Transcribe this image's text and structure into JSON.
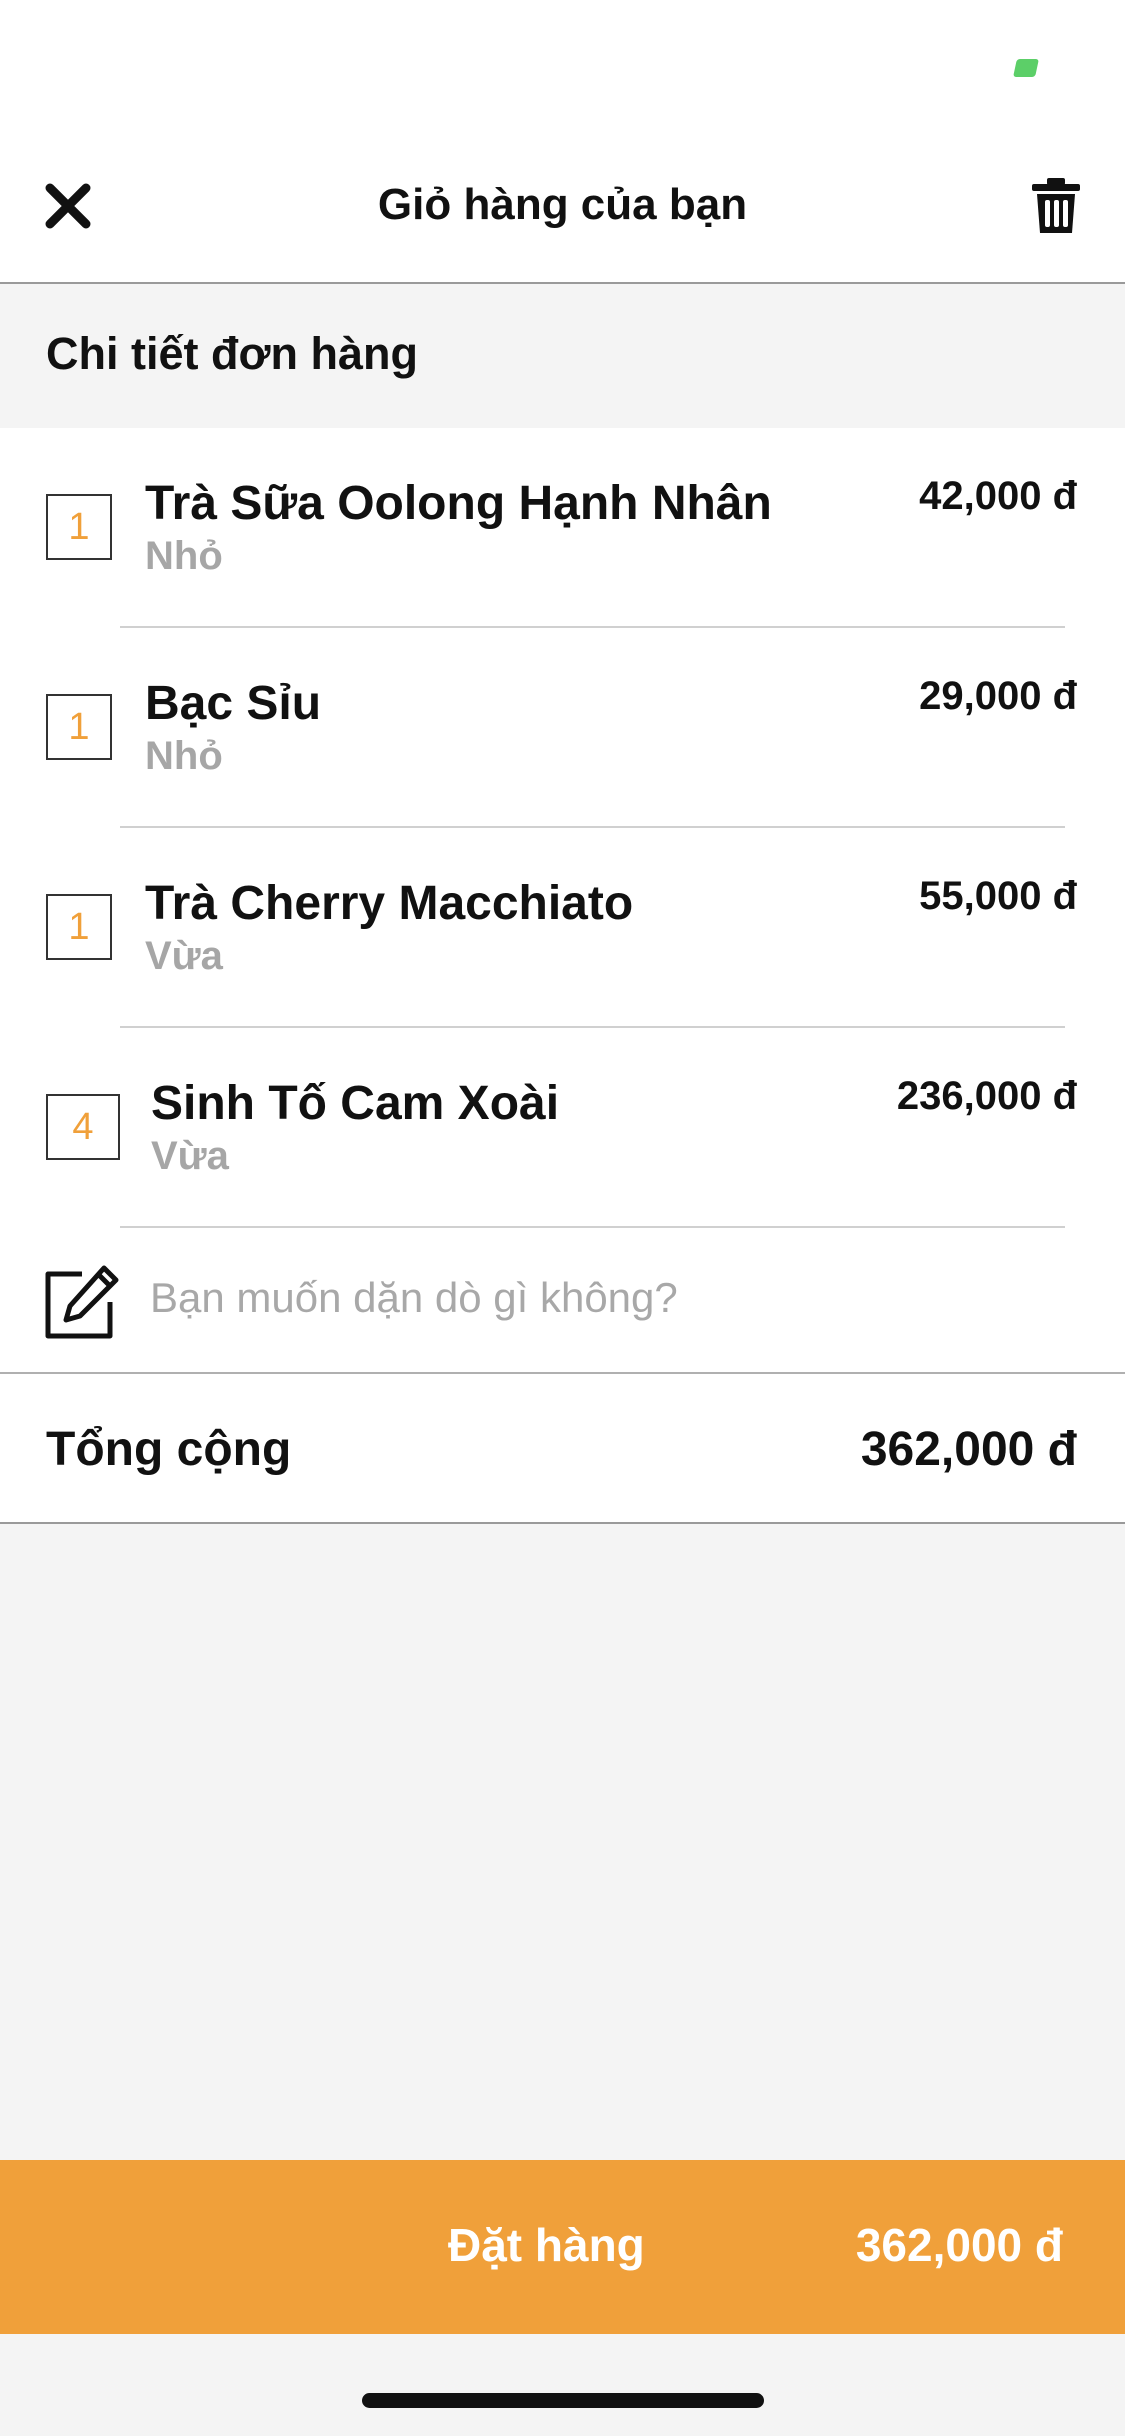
{
  "header": {
    "title": "Giỏ hàng của bạn",
    "close_icon": "close-icon",
    "trash_icon": "trash-icon"
  },
  "section": {
    "title": "Chi tiết đơn hàng"
  },
  "items": [
    {
      "qty": "1",
      "name": "Trà Sữa Oolong Hạnh Nhân",
      "size": "Nhỏ",
      "price": "42,000 đ"
    },
    {
      "qty": "1",
      "name": "Bạc Sỉu",
      "size": "Nhỏ",
      "price": "29,000 đ"
    },
    {
      "qty": "1",
      "name": "Trà Cherry Macchiato",
      "size": "Vừa",
      "price": "55,000 đ"
    },
    {
      "qty": "4",
      "name": "Sinh Tố Cam Xoài",
      "size": "Vừa",
      "price": "236,000 đ"
    }
  ],
  "note": {
    "placeholder": "Bạn muốn dặn dò gì không?",
    "value": "",
    "icon": "edit-note-icon"
  },
  "total": {
    "label": "Tổng cộng",
    "value": "362,000 đ"
  },
  "order_button": {
    "label": "Đặt hàng",
    "total": "362,000 đ"
  },
  "colors": {
    "accent": "#f0a03a",
    "status_indicator": "#5ccf68",
    "muted_text": "#a6a6a6",
    "background": "#f4f4f4"
  }
}
